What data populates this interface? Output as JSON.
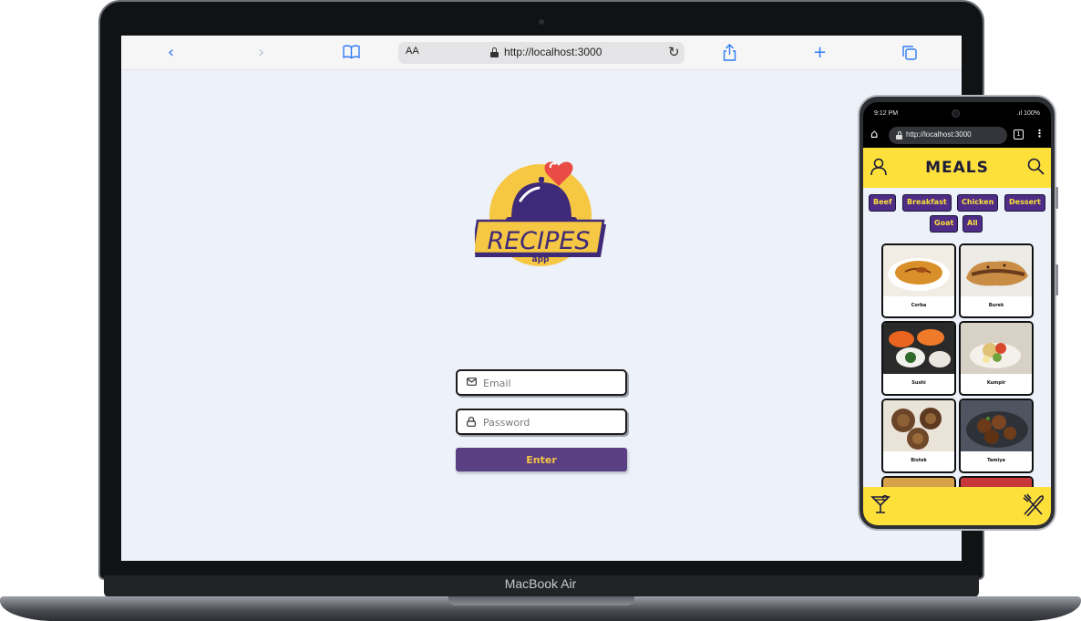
{
  "device": {
    "laptop_label": "MacBook Air"
  },
  "browser": {
    "text_size_label": "AA",
    "url": "http://localhost:3000",
    "icons": [
      "chevron-left-icon",
      "chevron-right-icon",
      "book-icon",
      "reload-icon",
      "share-icon",
      "plus-icon",
      "tabs-icon"
    ]
  },
  "login": {
    "logo_text": "RECIPES",
    "logo_subtext": "app",
    "email_placeholder": "Email",
    "password_placeholder": "Password",
    "enter_label": "Enter"
  },
  "mobile": {
    "status": {
      "time": "9:12 PM",
      "battery": ".ıl 100%"
    },
    "url": "http://localhost:3000",
    "tab_count": "1",
    "header_title": "MEALS",
    "categories": [
      "Beef",
      "Breakfast",
      "Chicken",
      "Dessert",
      "Goat",
      "All"
    ],
    "meals": [
      "Corba",
      "Burek",
      "Sushi",
      "Kumpir",
      "Bistek",
      "Tamiya"
    ]
  },
  "colors": {
    "accent_purple": "#4f2d86",
    "accent_yellow": "#fde03a",
    "page_background": "#edf1f9",
    "enter_button": "#5a3f85"
  }
}
